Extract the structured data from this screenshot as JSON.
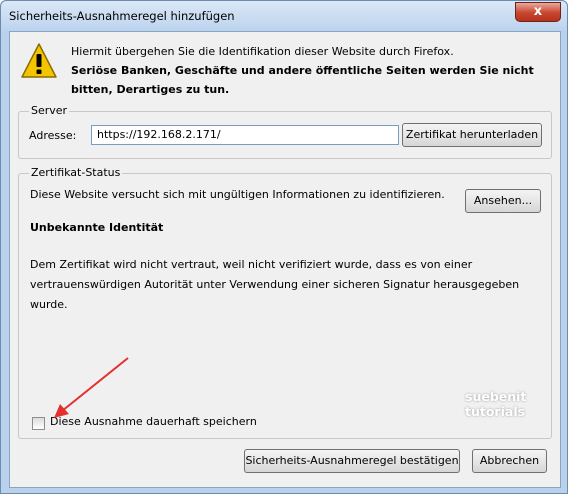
{
  "window": {
    "title": "Sicherheits-Ausnahmeregel hinzufügen",
    "close_label": "x"
  },
  "intro": {
    "line1": "Hiermit übergehen Sie die Identifikation dieser Website durch Firefox.",
    "line2": "Seriöse Banken, Geschäfte und andere öffentliche Seiten werden Sie nicht bitten, Derartiges zu tun."
  },
  "server": {
    "legend": "Server",
    "address_label": "Adresse:",
    "address_value": "https://192.168.2.171/",
    "download_button": "Zertifikat herunterladen"
  },
  "certificate": {
    "legend": "Zertifikat-Status",
    "info": "Diese Website versucht sich mit ungültigen Informationen zu identifizieren.",
    "view_button": "Ansehen...",
    "identity_heading": "Unbekannte Identität",
    "description": "Dem Zertifikat wird nicht vertraut, weil nicht verifiziert wurde, dass es von einer vertrauenswürdigen Autorität unter Verwendung einer sicheren Signatur herausgegeben wurde."
  },
  "permanent_checkbox": {
    "label": "Diese Ausnahme dauerhaft speichern",
    "checked": false
  },
  "watermark": {
    "line1": "suebenit",
    "line2": "tutorials"
  },
  "buttons": {
    "confirm": "Sicherheits-Ausnahmeregel bestätigen",
    "cancel": "Abbrechen"
  },
  "colors": {
    "arrow": "#e53030",
    "warning": "#f5c400"
  }
}
